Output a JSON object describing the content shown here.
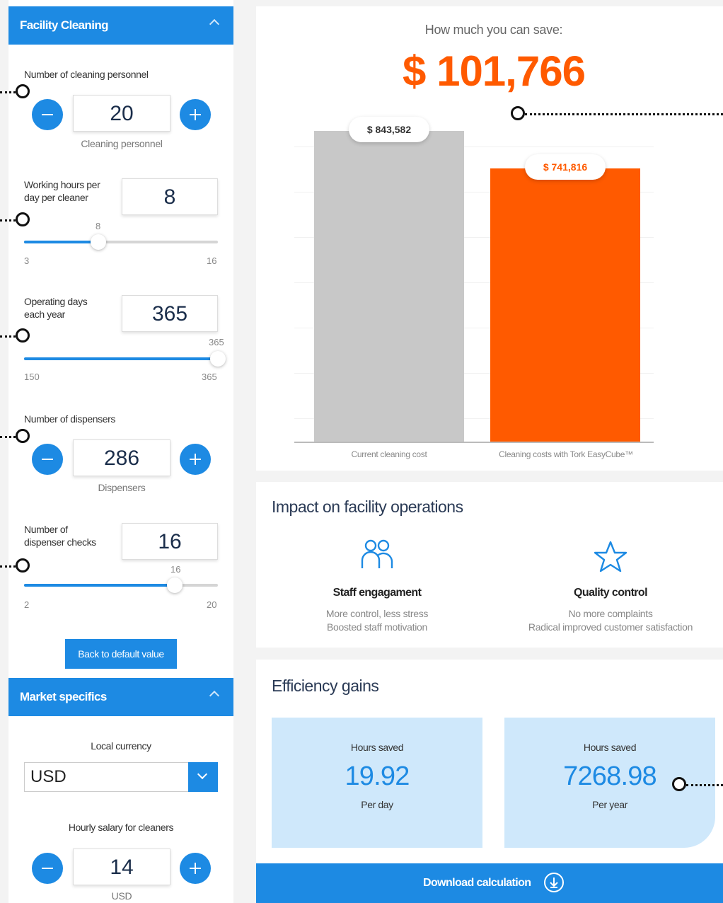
{
  "facility": {
    "title": "Facility Cleaning",
    "personnel": {
      "label": "Number of cleaning personnel",
      "value": "20",
      "sublabel": "Cleaning personnel"
    },
    "hours": {
      "label_line1": "Working hours per",
      "label_line2": "day per cleaner",
      "value": "8",
      "slider_value_label": "8",
      "min": "3",
      "max": "16",
      "fraction": 0.385
    },
    "days": {
      "label_line1": "Operating days",
      "label_line2": "each year",
      "value": "365",
      "slider_value_label": "365",
      "min": "150",
      "max": "365",
      "fraction": 1.0
    },
    "dispensers": {
      "label": "Number of dispensers",
      "value": "286",
      "sublabel": "Dispensers"
    },
    "checks": {
      "label_line1": "Number of",
      "label_line2": "dispenser checks",
      "value": "16",
      "slider_value_label": "16",
      "min": "2",
      "max": "20",
      "fraction": 0.778
    },
    "reset_label": "Back to default value"
  },
  "market": {
    "title": "Market specifics",
    "currency_label": "Local currency",
    "currency_value": "USD",
    "salary_label": "Hourly salary for cleaners",
    "salary_value": "14",
    "salary_sublabel": "USD"
  },
  "savings": {
    "heading": "How much you can save:",
    "amount": "$ 101,766"
  },
  "chart_data": {
    "type": "bar",
    "categories": [
      "Current cleaning cost",
      "Cleaning costs with Tork EasyCube™"
    ],
    "values": [
      843582,
      741816
    ],
    "value_labels": [
      "$ 843,582",
      "$ 741,816"
    ],
    "colors": [
      "#c8c8c8",
      "#ff5a00"
    ],
    "ylim": [
      0,
      1000000
    ],
    "grid": true
  },
  "impact": {
    "title": "Impact on facility operations",
    "items": [
      {
        "icon": "people-icon",
        "title": "Staff engagament",
        "line1": "More control, less stress",
        "line2": "Boosted staff motivation"
      },
      {
        "icon": "star-icon",
        "title": "Quality control",
        "line1": "No more complaints",
        "line2": "Radical improved customer satisfaction"
      }
    ]
  },
  "efficiency": {
    "title": "Efficiency gains",
    "cards": [
      {
        "label": "Hours saved",
        "value": "19.92",
        "unit": "Per day"
      },
      {
        "label": "Hours saved",
        "value": "7268.98",
        "unit": "Per year"
      }
    ]
  },
  "download": {
    "label": "Download calculation",
    "icon": "download-icon"
  },
  "colors": {
    "accent": "#1d8ae3",
    "savings": "#ff5a00",
    "eff_bg": "#cfe8fb"
  }
}
